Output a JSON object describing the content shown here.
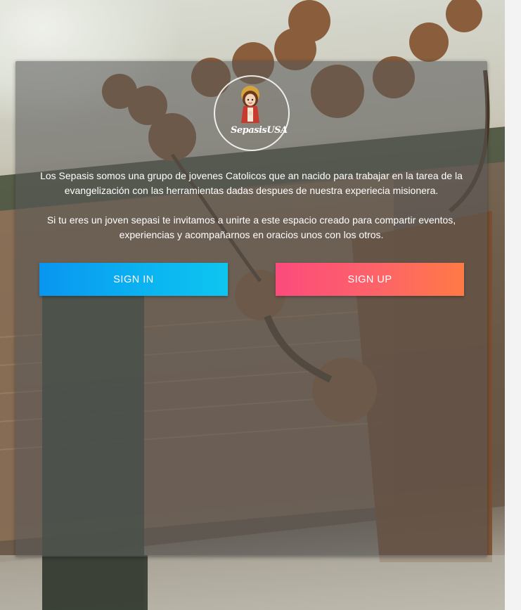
{
  "logo": {
    "word": "SepasisUSA",
    "alt": "Sepasis USA logo"
  },
  "description": {
    "paragraph1": "Los Sepasis somos una grupo de jovenes Catolicos que an nacido para trabajar en la tarea de la evangelización con las herramientas dadas despues de nuestra experiecia misionera.",
    "paragraph2": "Si tu eres un joven sepasi te invitamos a unirte a este espacio creado para compartir eventos, experiencias y acompañarnos en oracios unos con los otros."
  },
  "buttons": {
    "sign_in": "SIGN IN",
    "sign_up": "SIGN UP"
  },
  "colors": {
    "sign_in_start": "#0996f0",
    "sign_in_end": "#0ec5f0",
    "sign_up_start": "#fc4b7c",
    "sign_up_end": "#fe7a45",
    "overlay": "rgba(85,85,85,0.55)",
    "text": "#ffffff"
  }
}
